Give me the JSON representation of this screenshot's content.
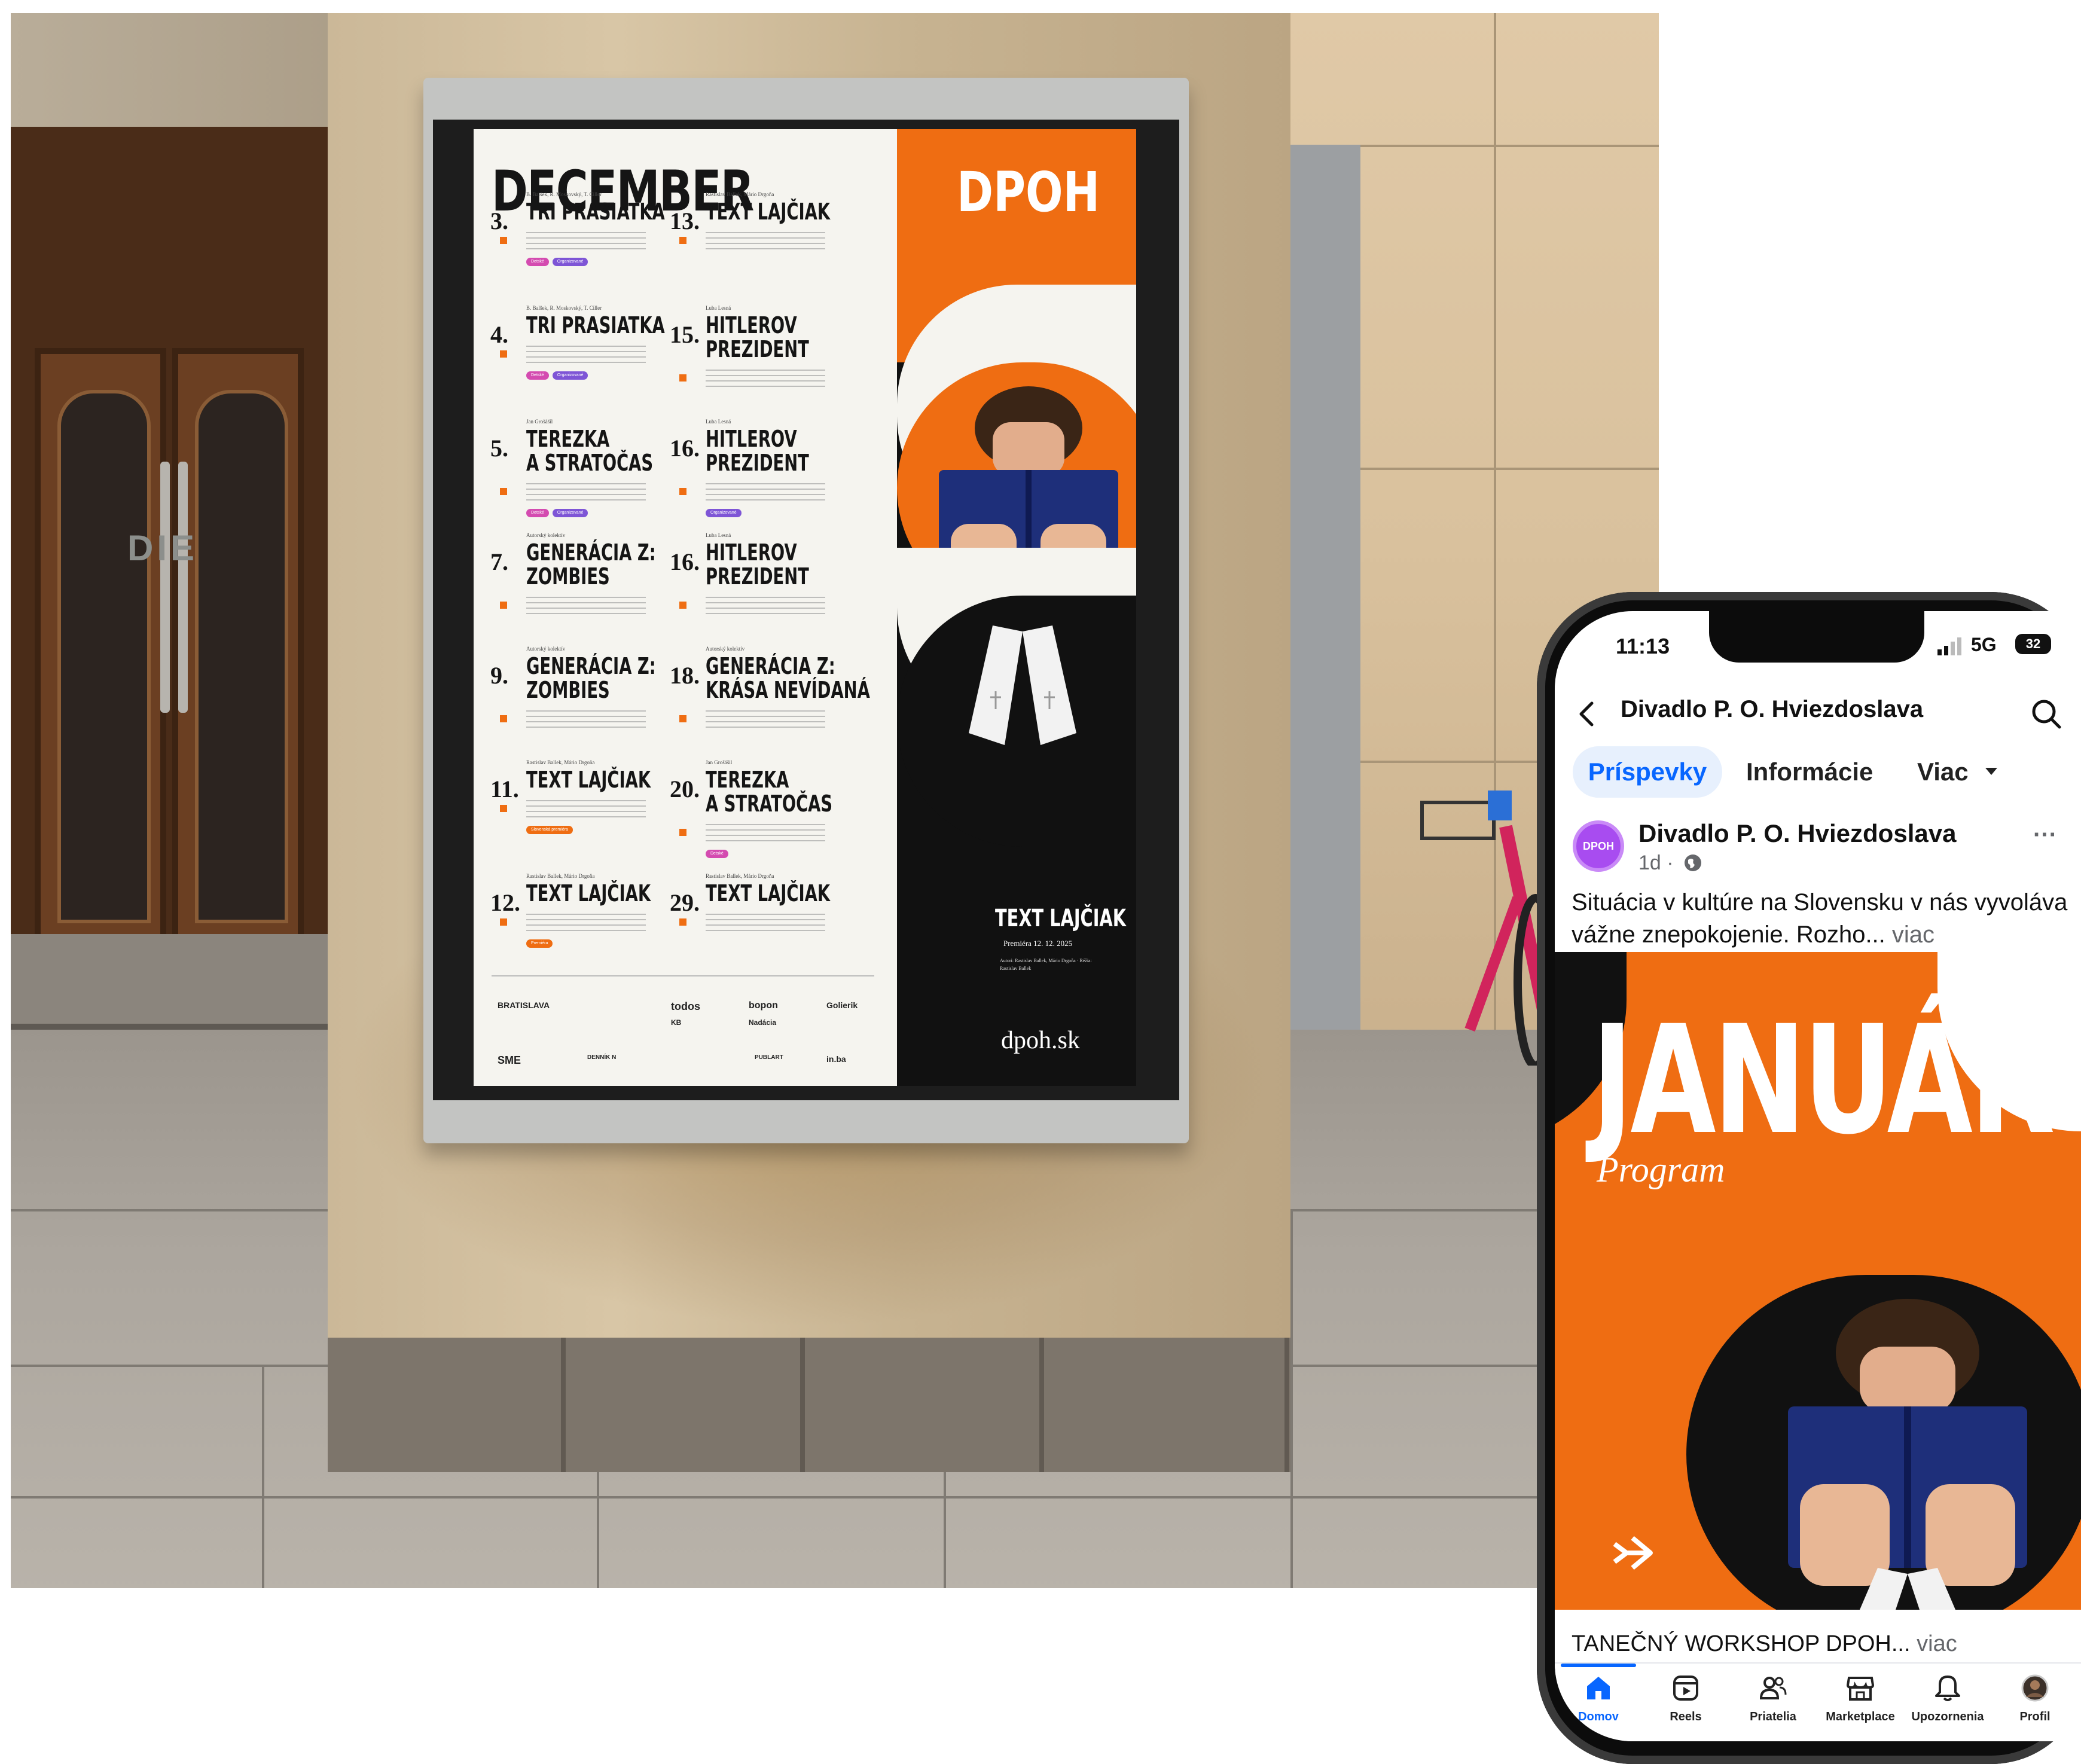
{
  "poster": {
    "month": "DECEMBER",
    "brand": "DPOH",
    "events_left": [
      {
        "num": "3.",
        "credit": "B. Balšek, R. Moskovský, T. Ciller",
        "title": "TRI PRASIATKA",
        "tags": [
          "Detské",
          "Organizované"
        ]
      },
      {
        "num": "4.",
        "credit": "B. Balšek, R. Moskovský, T. Ciller",
        "title": "TRI PRASIATKA",
        "tags": [
          "Detské",
          "Organizované"
        ]
      },
      {
        "num": "5.",
        "credit": "Jan Grošášil",
        "title": "TEREZKA",
        "title2": "A STRATOČAS",
        "tags": [
          "Detské",
          "Organizované"
        ]
      },
      {
        "num": "7.",
        "credit": "Autorský kolektív",
        "title": "GENERÁCIA Z:",
        "title2": "ZOMBIES",
        "tags": []
      },
      {
        "num": "9.",
        "credit": "Autorský kolektív",
        "title": "GENERÁCIA Z:",
        "title2": "ZOMBIES",
        "tags": []
      },
      {
        "num": "11.",
        "credit": "Rastislav Ballek, Mário Drgoňa",
        "title": "TEXT LAJČIAK",
        "tags": [
          "Slovenská premiéra"
        ]
      },
      {
        "num": "12.",
        "credit": "Rastislav Ballek, Mário Drgoňa",
        "title": "TEXT LAJČIAK",
        "tags": [
          "Premiéra"
        ]
      }
    ],
    "events_right": [
      {
        "num": "13.",
        "credit": "Rastislav Ballek, Mário Drgoňa",
        "title": "TEXT LAJČIAK",
        "tags": []
      },
      {
        "num": "15.",
        "credit": "Luba Lesná",
        "title": "HITLEROV",
        "title2": "PREZIDENT",
        "tags": []
      },
      {
        "num": "16.",
        "credit": "Luba Lesná",
        "title": "HITLEROV",
        "title2": "PREZIDENT",
        "tags": [
          "Organizované"
        ]
      },
      {
        "num": "16.",
        "credit": "Luba Lesná",
        "title": "HITLEROV",
        "title2": "PREZIDENT",
        "tags": []
      },
      {
        "num": "18.",
        "credit": "Autorský kolektív",
        "title": "GENERÁCIA Z:",
        "title2": "KRÁSA NEVÍDANÁ",
        "tags": []
      },
      {
        "num": "20.",
        "credit": "Jan Grošášil",
        "title": "TEREZKA",
        "title2": "A STRATOČAS",
        "tags": [
          "Detské"
        ]
      },
      {
        "num": "29.",
        "credit": "Rastislav Ballek, Mário Drgoňa",
        "title": "TEXT LAJČIAK",
        "tags": []
      }
    ],
    "sponsors": [
      "BRATISLAVA",
      "todos",
      "bopon",
      "Golierik",
      "KB",
      "Nadácia",
      "SME",
      "DENNÍK N",
      "PUBLART",
      "in.ba"
    ],
    "feature": {
      "title": "TEXT LAJČIAK",
      "date": "Premiéra 12. 12. 2025",
      "credits": "Autori: Rastislav Ballek, Mário Drgoňa · Réžia: Rastislav Ballek"
    },
    "url": "dpoh.sk"
  },
  "scene": {
    "door_sign": "DIE"
  },
  "phone": {
    "status": {
      "time": "11:13",
      "network": "5G",
      "battery": "32"
    },
    "header": {
      "page_name": "Divadlo P. O. Hviezdoslava"
    },
    "tabs": [
      {
        "label": "Príspevky"
      },
      {
        "label": "Informácie"
      },
      {
        "label": "Viac"
      }
    ],
    "post": {
      "avatar_text": "DPOH",
      "author": "Divadlo P. O. Hviezdoslava",
      "time": "1d ·",
      "more": "···",
      "text": "Situácia v kultúre na Slovensku v nás vyvoláva vážne znepokojenie. Rozho...",
      "text_more": " viac",
      "image_title": "JANUÁR",
      "image_subtitle": "Program"
    },
    "next_post": {
      "text": "TANEČNÝ WORKSHOP DPOH...",
      "more": " viac"
    },
    "bottom_nav": [
      {
        "label": "Domov",
        "icon": "home-icon"
      },
      {
        "label": "Reels",
        "icon": "reels-icon"
      },
      {
        "label": "Priatelia",
        "icon": "friends-icon"
      },
      {
        "label": "Marketplace",
        "icon": "marketplace-icon"
      },
      {
        "label": "Upozornenia",
        "icon": "bell-icon"
      },
      {
        "label": "Profil",
        "icon": "profile-icon"
      }
    ],
    "colors": {
      "accent": "#0866ff",
      "brand_orange": "#ef6d12"
    }
  }
}
